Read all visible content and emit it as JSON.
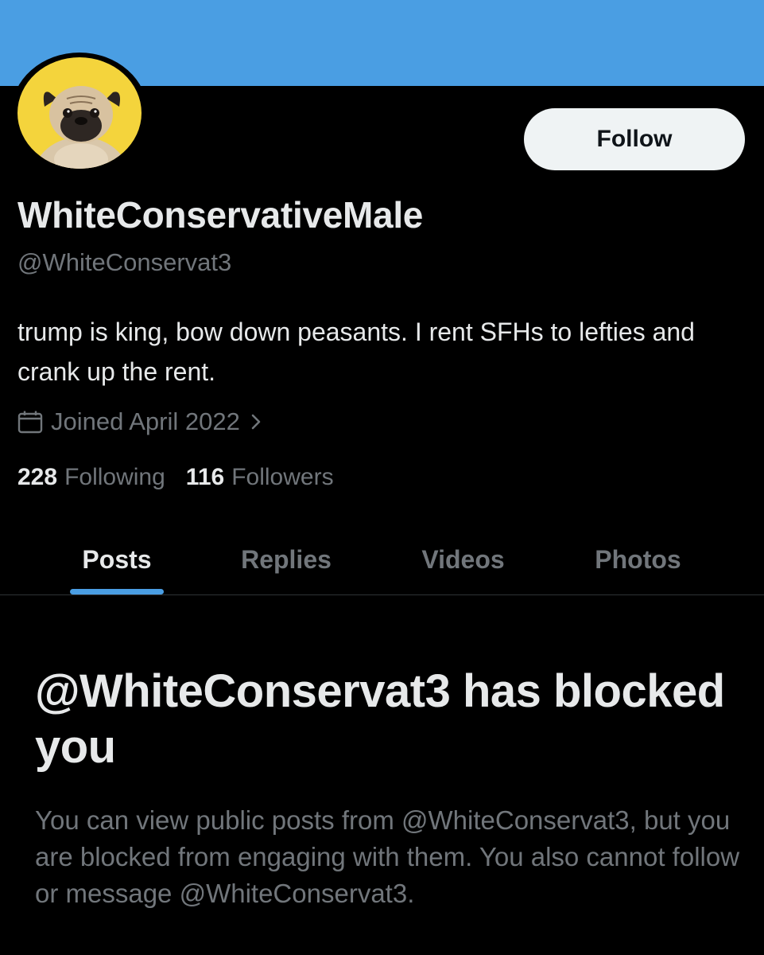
{
  "profile": {
    "display_name": "WhiteConservativeMale",
    "handle": "@WhiteConservat3",
    "bio": "trump is king, bow down peasants. I rent SFHs to lefties and crank up the rent.",
    "joined": "Joined April 2022",
    "avatar_icon": "pug-avatar-icon",
    "banner_color": "#4a9ee3"
  },
  "actions": {
    "follow_label": "Follow"
  },
  "stats": {
    "following_count": "228",
    "following_label": "Following",
    "followers_count": "116",
    "followers_label": "Followers"
  },
  "tabs": [
    {
      "label": "Posts",
      "active": true
    },
    {
      "label": "Replies",
      "active": false
    },
    {
      "label": "Videos",
      "active": false
    },
    {
      "label": "Photos",
      "active": false
    }
  ],
  "blocked": {
    "title": "@WhiteConservat3 has blocked you",
    "description": "You can view public posts from @WhiteConservat3, but you are blocked from engaging with them. You also cannot follow or message @WhiteConservat3."
  },
  "colors": {
    "accent": "#4a9ee3",
    "text_primary": "#e7e9ea",
    "text_secondary": "#71767b",
    "background": "#000000"
  }
}
